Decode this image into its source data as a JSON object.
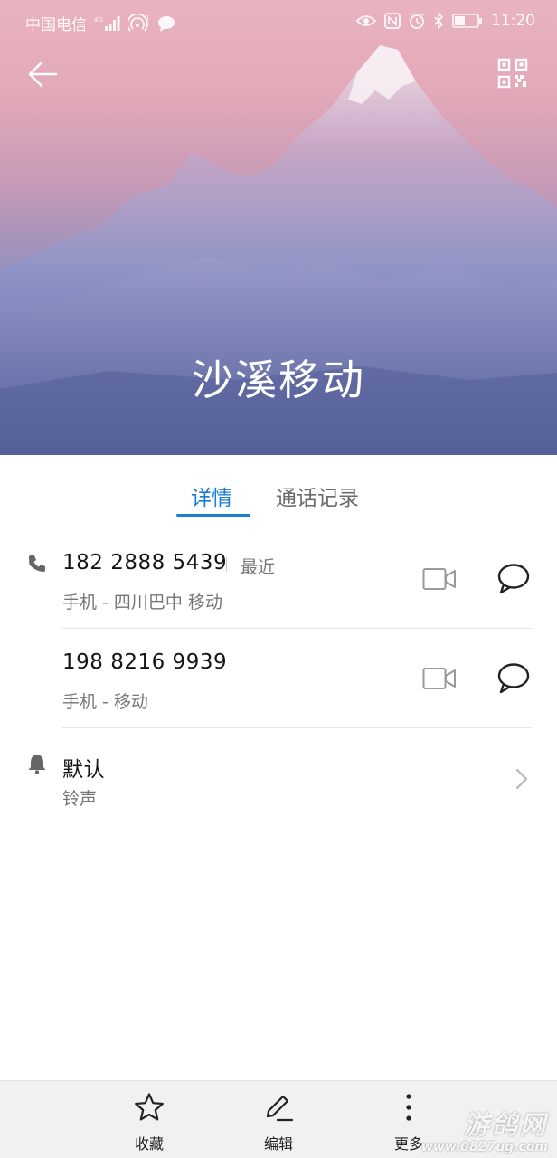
{
  "status_bar": {
    "carrier": "中国电信",
    "network": "4G",
    "time": "11:20",
    "icons": [
      "signal-icon",
      "hotspot-icon",
      "message-notification-icon",
      "eye-comfort-icon",
      "nfc-icon",
      "alarm-icon",
      "bluetooth-icon",
      "battery-icon"
    ]
  },
  "header": {
    "contact_name": "沙溪移动",
    "back_icon": "arrow-left-icon",
    "qr_icon": "qr-code-icon"
  },
  "tabs": [
    {
      "label": "详情",
      "active": true
    },
    {
      "label": "通话记录",
      "active": false
    }
  ],
  "numbers": [
    {
      "number": "182 2888 5439",
      "tag": "最近",
      "type_label": "手机 - 四川巴中 移动"
    },
    {
      "number": "198 8216 9939",
      "tag": "",
      "type_label": "手机 - 移动"
    }
  ],
  "ringtone": {
    "value": "默认",
    "label": "铃声"
  },
  "bottom_bar": {
    "favorite": "收藏",
    "edit": "编辑",
    "more": "更多"
  },
  "watermark": {
    "text": "游鸽网",
    "url": "www.0827ug.com"
  },
  "colors": {
    "accent": "#1a7fd4",
    "header_top": "#e9b3bf",
    "header_bottom": "#5c679e"
  }
}
